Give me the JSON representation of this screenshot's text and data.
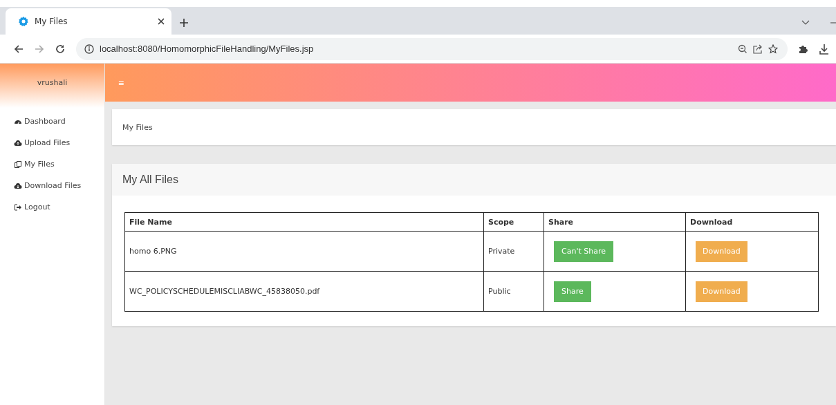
{
  "browser": {
    "tab": {
      "title": "My Files"
    },
    "url": "localhost:8080/HomomorphicFileHandling/MyFiles.jsp"
  },
  "sidebar": {
    "user": "vrushali",
    "items": [
      {
        "label": "Dashboard",
        "kind": "dashboard"
      },
      {
        "label": "Upload Files",
        "kind": "upload"
      },
      {
        "label": "My Files",
        "kind": "files"
      },
      {
        "label": "Download Files",
        "kind": "download"
      },
      {
        "label": "Logout",
        "kind": "logout"
      }
    ]
  },
  "header": {
    "menu_icon": "≡"
  },
  "breadcrumb": "My Files",
  "panel": {
    "title": "My All Files",
    "table": {
      "columns": [
        "File Name",
        "Scope",
        "Share",
        "Download"
      ],
      "rows": [
        {
          "file_name": "homo 6.PNG",
          "scope": "Private",
          "share": "Can't Share",
          "download": "Download"
        },
        {
          "file_name": "WC_POLICYSCHEDULEMISCLIABWC_45838050.pdf",
          "scope": "Public",
          "share": "Share",
          "download": "Download"
        }
      ]
    }
  }
}
